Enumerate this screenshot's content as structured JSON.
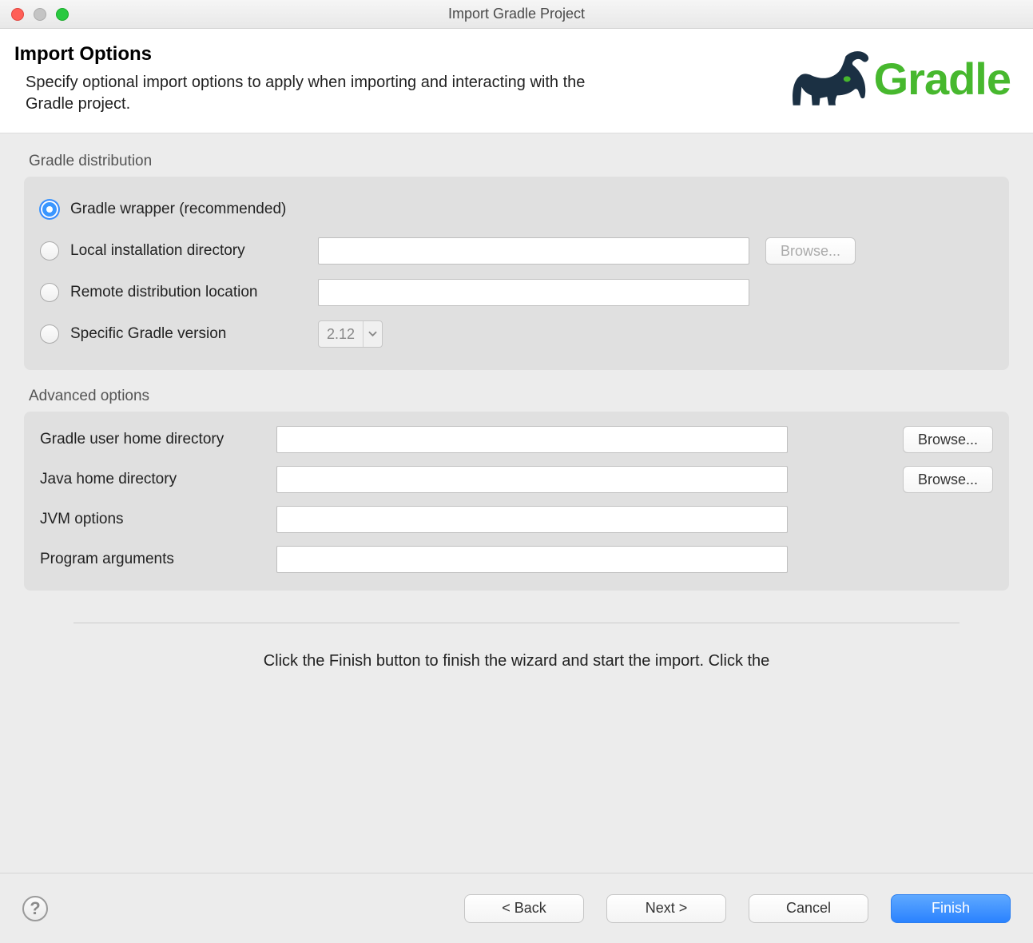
{
  "window": {
    "title": "Import Gradle Project"
  },
  "header": {
    "title": "Import Options",
    "description": "Specify optional import options to apply when importing and interacting with the Gradle project.",
    "logo_word": "Gradle"
  },
  "distribution": {
    "label": "Gradle distribution",
    "options": {
      "wrapper": "Gradle wrapper (recommended)",
      "local": "Local installation directory",
      "remote": "Remote distribution location",
      "specific": "Specific Gradle version"
    },
    "local_value": "",
    "remote_value": "",
    "version_value": "2.12",
    "browse_label": "Browse..."
  },
  "advanced": {
    "label": "Advanced options",
    "user_home_label": "Gradle user home directory",
    "user_home_value": "",
    "java_home_label": "Java home directory",
    "java_home_value": "",
    "jvm_options_label": "JVM options",
    "jvm_options_value": "",
    "program_args_label": "Program arguments",
    "program_args_value": "",
    "browse_label": "Browse..."
  },
  "hint": "Click the Finish button to finish the wizard and start the import. Click the",
  "buttons": {
    "back": "< Back",
    "next": "Next >",
    "cancel": "Cancel",
    "finish": "Finish"
  }
}
